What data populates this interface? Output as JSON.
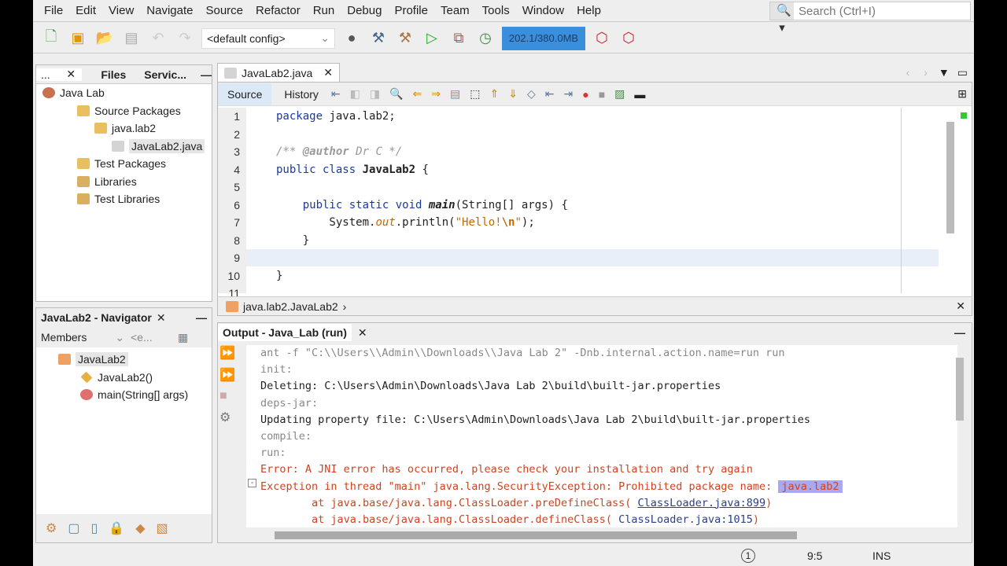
{
  "menu": [
    "File",
    "Edit",
    "View",
    "Navigate",
    "Source",
    "Refactor",
    "Run",
    "Debug",
    "Profile",
    "Team",
    "Tools",
    "Window",
    "Help"
  ],
  "search": {
    "placeholder": "Search (Ctrl+I)"
  },
  "toolbar": {
    "config": "<default config>",
    "memory": "202.1/380.0MB"
  },
  "projects": {
    "tabs": [
      "...",
      "Files",
      "Servic..."
    ],
    "tree": [
      "Java Lab",
      "Source Packages",
      "java.lab2",
      "JavaLab2.java",
      "Test Packages",
      "Libraries",
      "Test Libraries"
    ]
  },
  "navigator": {
    "title": "JavaLab2 - Navigator",
    "filter": "Members",
    "filter2": "<e...",
    "tree": [
      "JavaLab2",
      "JavaLab2()",
      "main(String[] args)"
    ]
  },
  "editor": {
    "tab": "JavaLab2.java",
    "source": "Source",
    "history": "History",
    "breadcrumb": "java.lab2.JavaLab2",
    "lines": [
      "1",
      "2",
      "3",
      "4",
      "5",
      "6",
      "7",
      "8",
      "9",
      "10",
      "11"
    ]
  },
  "output": {
    "title": "Output - Java_Lab (run)",
    "lines": [
      "ant -f \"C:\\\\Users\\\\Admin\\\\Downloads\\\\Java Lab 2\" -Dnb.internal.action.name=run run",
      "init:",
      "Deleting: C:\\Users\\Admin\\Downloads\\Java Lab 2\\build\\built-jar.properties",
      "deps-jar:",
      "Updating property file: C:\\Users\\Admin\\Downloads\\Java Lab 2\\build\\built-jar.properties",
      "compile:",
      "run:",
      "Error: A JNI error has occurred, please check your installation and try again",
      "Exception in thread \"main\" java.lang.SecurityException: Prohibited package name: ",
      "        at java.base/java.lang.ClassLoader.preDefineClass(",
      "        at java.base/java.lang.ClassLoader.defineClass("
    ],
    "highlight": "java.lab2",
    "link1": "ClassLoader.java:899",
    "link2": "ClassLoader.java:1015"
  },
  "status": {
    "notifications": "1",
    "position": "9:5",
    "mode": "INS"
  }
}
